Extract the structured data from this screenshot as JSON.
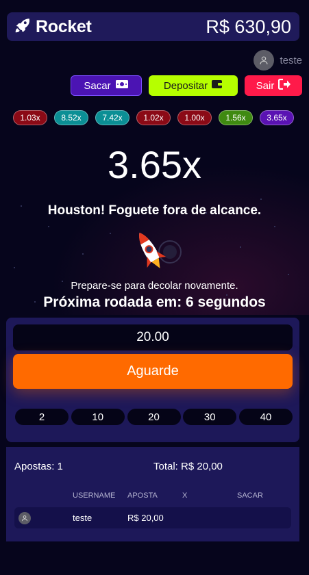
{
  "header": {
    "brand": "Rocket",
    "balance": "R$ 630,90",
    "icon": "rocket-icon"
  },
  "user": {
    "name": "teste",
    "icon": "user-icon"
  },
  "actions": {
    "withdraw_label": "Sacar",
    "withdraw_icon": "money-icon",
    "deposit_label": "Depositar",
    "deposit_icon": "wallet-icon",
    "logout_label": "Sair",
    "logout_icon": "logout-icon"
  },
  "history": [
    {
      "value": "1.03x",
      "color": "#8b0a16"
    },
    {
      "value": "8.52x",
      "color": "#0b8f95"
    },
    {
      "value": "7.42x",
      "color": "#0b8f95"
    },
    {
      "value": "1.02x",
      "color": "#8b0a16"
    },
    {
      "value": "1.00x",
      "color": "#8b0a16"
    },
    {
      "value": "1.56x",
      "color": "#3f8a11"
    },
    {
      "value": "3.65x",
      "color": "#5a12b3"
    }
  ],
  "game": {
    "multiplier": "3.65x",
    "message": "Houston! Foguete fora de alcance.",
    "prepare": "Prepare-se para decolar novamente.",
    "countdown": "Próxima rodada em: 6 segundos"
  },
  "bet": {
    "amount": "20.00",
    "action_label": "Aguarde",
    "quick_values": [
      "2",
      "10",
      "20",
      "30",
      "40"
    ]
  },
  "bets": {
    "count_label": "Apostas: 1",
    "total_label": "Total: R$ 20,00",
    "columns": [
      "USERNAME",
      "APOSTA",
      "X",
      "SACAR"
    ],
    "rows": [
      {
        "username": "teste",
        "aposta": "R$ 20,00",
        "x": "",
        "sacar": ""
      }
    ]
  },
  "colors": {
    "accent_orange": "#ff6a00",
    "deposit_green": "#b6ff00",
    "logout_red": "#ff1a4a",
    "withdraw_purple": "#4b14b3",
    "panel": "#1d1859"
  }
}
